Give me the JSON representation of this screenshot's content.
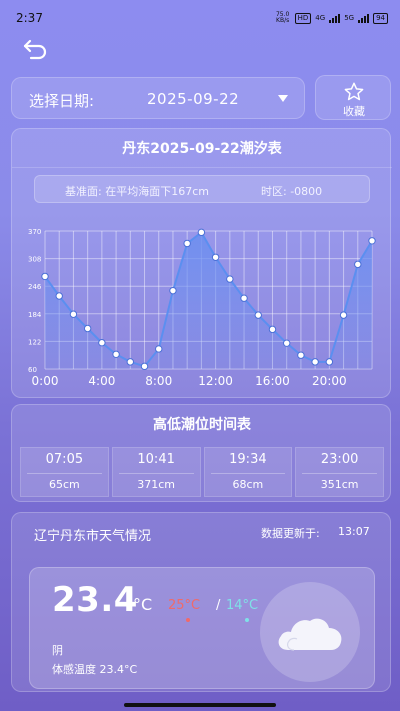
{
  "status_bar": {
    "time": "2:37",
    "speed": "75.0 KB/s",
    "hd": "HD",
    "network": "4G",
    "network2": "5G",
    "battery": "94"
  },
  "date_selector": {
    "label": "选择日期:",
    "value": "2025-09-22"
  },
  "favorite": {
    "label": "收藏"
  },
  "tide_chart": {
    "title": "丹东2025-09-22潮汐表",
    "datum": "基准面: 在平均海面下167cm",
    "timezone": "时区: -0800"
  },
  "chart_data": {
    "type": "line",
    "x": [
      "0:00",
      "1:00",
      "2:00",
      "3:00",
      "4:00",
      "5:00",
      "6:00",
      "7:00",
      "8:00",
      "9:00",
      "10:00",
      "11:00",
      "12:00",
      "13:00",
      "14:00",
      "15:00",
      "16:00",
      "17:00",
      "18:00",
      "19:00",
      "20:00",
      "21:00",
      "22:00",
      "23:00"
    ],
    "xticks": [
      "0:00",
      "4:00",
      "8:00",
      "12:00",
      "16:00",
      "20:00"
    ],
    "yticks": [
      "60",
      "122",
      "184",
      "246",
      "308",
      "370"
    ],
    "ylim": [
      60,
      370
    ],
    "values": [
      268,
      224,
      183,
      151,
      119,
      93,
      76,
      66,
      105,
      236,
      342,
      367,
      311,
      262,
      219,
      181,
      149,
      118,
      91,
      76,
      76,
      181,
      295,
      348
    ],
    "line_color": "#5b8ff0",
    "area_color": "#6a8ef0",
    "grid": true
  },
  "high_low": {
    "title": "高低潮位时间表",
    "entries": [
      {
        "time": "07:05",
        "height": "65cm"
      },
      {
        "time": "10:41",
        "height": "371cm"
      },
      {
        "time": "19:34",
        "height": "68cm"
      },
      {
        "time": "23:00",
        "height": "351cm"
      }
    ]
  },
  "weather": {
    "title": "辽宁丹东市天气情况",
    "updated_label": "数据更新于:",
    "updated_time": "13:07",
    "temperature": "23.4",
    "unit": "°C",
    "high": "25°C",
    "low": "14°C",
    "slash": "/",
    "condition": "阴",
    "feels_like": "体感温度 23.4°C",
    "icon": "cloud-icon",
    "high_color": "#f06a6a",
    "low_color": "#7fe1e8"
  }
}
